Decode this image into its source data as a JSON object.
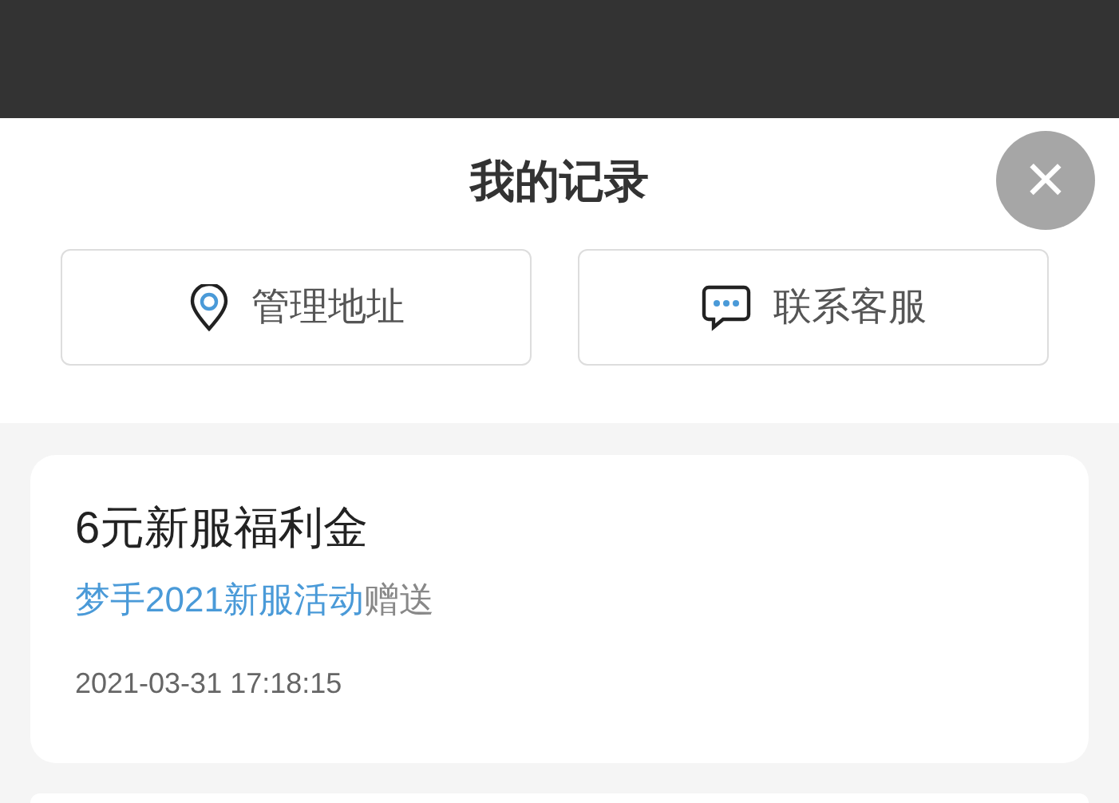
{
  "sheet": {
    "title": "我的记录",
    "close": "×"
  },
  "actions": [
    {
      "kind": "location",
      "label": "管理地址"
    },
    {
      "kind": "chat",
      "label": "联系客服"
    }
  ],
  "records": [
    {
      "title": "6元新服福利金",
      "source_link": "梦手2021新服活动",
      "source_suffix": "赠送",
      "time": "2021-03-31 17:18:15"
    }
  ]
}
